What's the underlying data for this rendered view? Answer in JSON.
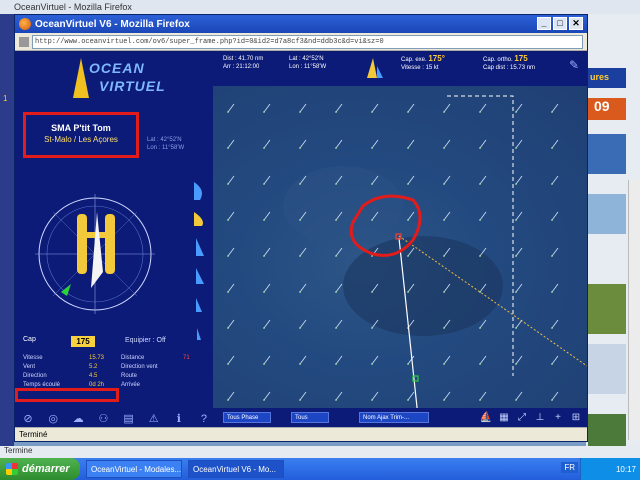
{
  "browser_bg": {
    "title": "OceanVirtuel - Mozilla Firefox",
    "left_tab": "1",
    "right_ad_text": "ures",
    "right_ad_number": "09",
    "desktop_status": "Termine"
  },
  "popup": {
    "title": "OceanVirtuel V6 - Mozilla Firefox",
    "url": "http://www.oceanvirtuel.com/ov6/super_frame.php?id=0&id2=d7a8cf3&nd=ddb3c&d=vi&sz=0",
    "status": "Terminé"
  },
  "left_panel": {
    "logo_line1": "OCEAN",
    "logo_line2": "VIRTUEL",
    "boat_name": "SMA P'tit Tom",
    "boat_home": "St-Malo / Les Açores",
    "lat": "Lat : 42°52'N",
    "lon": "Lon : 11°58'W",
    "cap_label": "Cap",
    "cap_value": "175",
    "equipier_label": "Equipier : Off",
    "stats": [
      {
        "l": "Vitesse",
        "v": "15.73",
        "l2": "Distance",
        "v2": "71"
      },
      {
        "l": "Vent",
        "v": "5.2",
        "l2": "Direction vent",
        "v2": ""
      },
      {
        "l": "Direction",
        "v": "4.5",
        "l2": "Route",
        "v2": ""
      },
      {
        "l": "Temps écoulé",
        "v": "0d 2h",
        "l2": "Arrivée",
        "v2": ""
      }
    ]
  },
  "top_bar": {
    "items": [
      {
        "label": "Dist : 41.70 nm",
        "sub": "Arr : 21:12:00"
      },
      {
        "label": "Lat : 42°52'N",
        "sub": "Lon : 11°58'W"
      },
      {
        "label": "Cap. exe.",
        "big": "175°",
        "sub": "Vitesse : 15 kt"
      },
      {
        "label": "Cap. ortho.",
        "big": "175",
        "sub": "Cap dist : 15.73 nm"
      }
    ]
  },
  "map_bottom": {
    "select1": "Tous Phase",
    "select2": "Tous",
    "select3": "Nom Ajax Trim-..."
  },
  "taskbar": {
    "start": "démarrer",
    "task1": "OceanVirtuel - Modales...",
    "task2": "OceanVirtuel V6 - Mo...",
    "lang": "FR",
    "clock": "10:17"
  },
  "colors": {
    "panel": "#0c1a78",
    "highlight_red": "#e21b1b",
    "cap_box": "#f7d23e",
    "route_white": "#ffffff",
    "ortho_dash": "#f0c040"
  }
}
